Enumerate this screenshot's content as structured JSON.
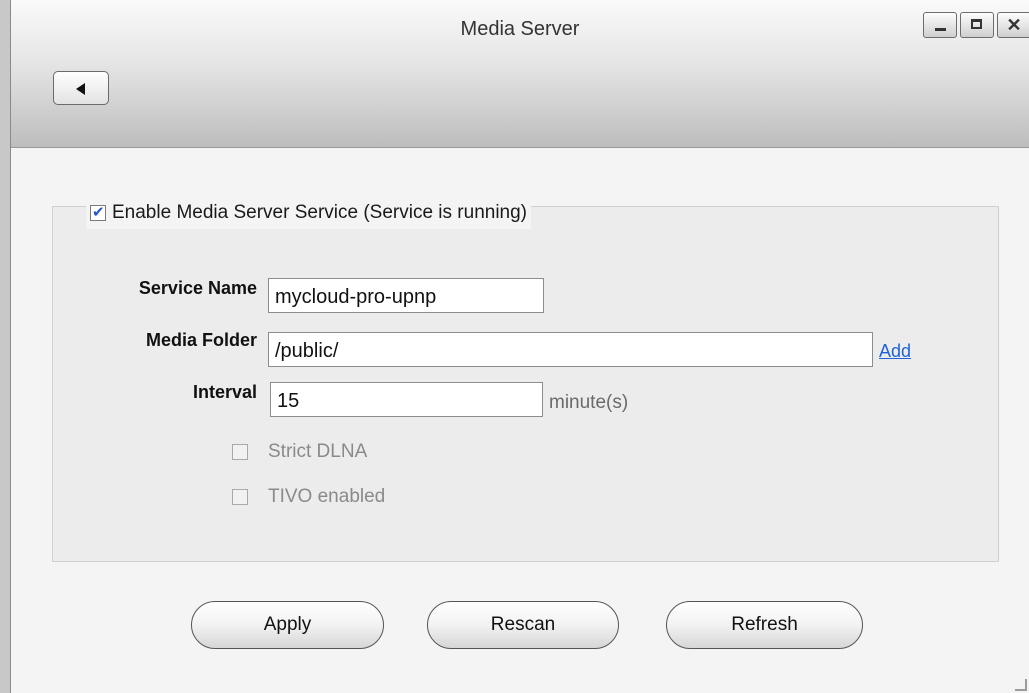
{
  "window": {
    "title": "Media Server"
  },
  "icons": {
    "back": "back-arrow-icon",
    "minimize": "minimize-icon",
    "maximize": "maximize-icon",
    "close": "close-icon"
  },
  "colors": {
    "link": "#1f63d8",
    "checkbox_accent": "#2255c8"
  },
  "service": {
    "enable_label": "Enable Media Server Service (Service is running)",
    "enabled": true
  },
  "form": {
    "service_name_label": "Service Name",
    "service_name_value": "mycloud-pro-upnp",
    "media_folder_label": "Media Folder",
    "media_folder_value": "/public/",
    "add_link": "Add",
    "interval_label": "Interval",
    "interval_value": "15",
    "interval_units": "minute(s)",
    "strict_dlna_label": "Strict DLNA",
    "strict_dlna_checked": false,
    "tivo_label": "TIVO enabled",
    "tivo_checked": false
  },
  "buttons": {
    "apply": "Apply",
    "rescan": "Rescan",
    "refresh": "Refresh"
  }
}
